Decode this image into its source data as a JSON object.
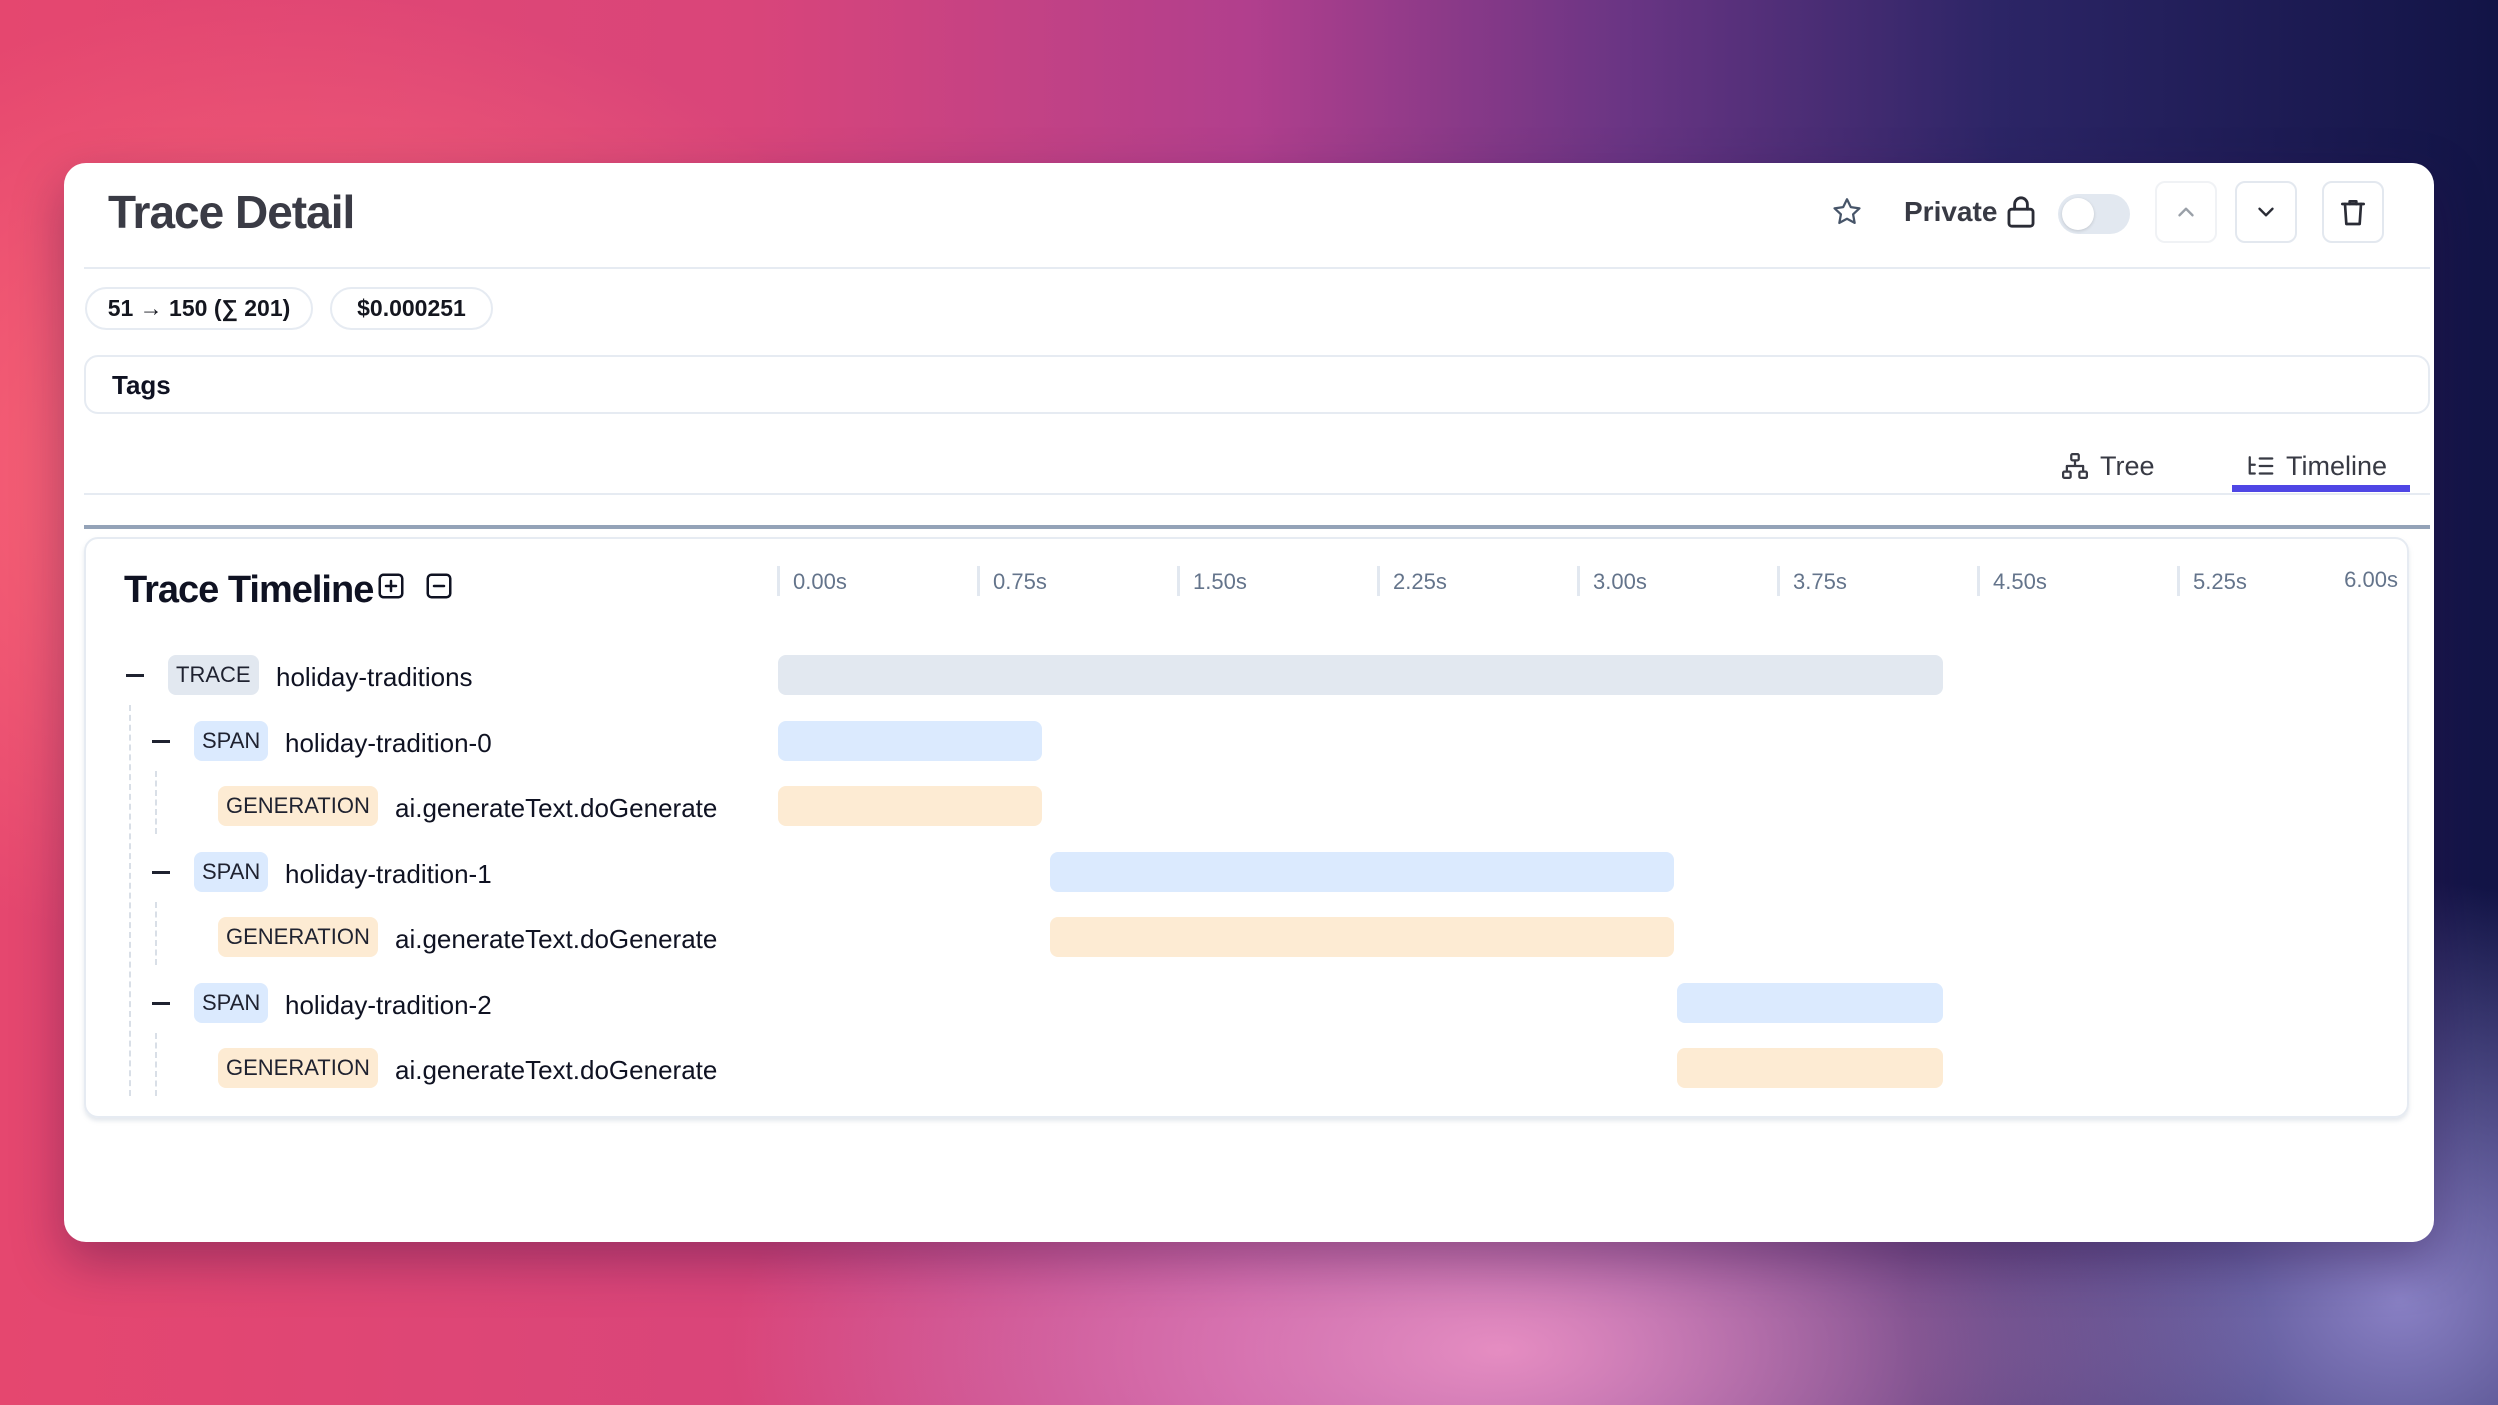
{
  "header": {
    "title": "Trace Detail",
    "private_label": "Private",
    "private_enabled": false,
    "icons": {
      "bookmark": "star-icon",
      "visibility": "lock-icon",
      "previous": "chevron-up-icon",
      "next": "chevron-down-icon",
      "delete": "trash-icon"
    },
    "previous_disabled": true
  },
  "stats": {
    "tokens": "51 → 150 (∑ 201)",
    "cost": "$0.000251"
  },
  "tags": {
    "label": "Tags"
  },
  "view_tabs": [
    {
      "label": "Tree",
      "icon": "tree-icon",
      "active": false
    },
    {
      "label": "Timeline",
      "icon": "timeline-icon",
      "active": true
    }
  ],
  "colors": {
    "accent": "#4f46e5",
    "trace_bar": "#e2e8f0",
    "span_bar": "#dbeafe",
    "generation_bar": "#fdebd3"
  },
  "timeline": {
    "title": "Trace Timeline",
    "expand_all_icon": "plus-square-icon",
    "collapse_all_icon": "minus-square-icon",
    "axis": {
      "min": 0,
      "max": 6.0,
      "ticks": [
        "0.00s",
        "0.75s",
        "1.50s",
        "2.25s",
        "3.00s",
        "3.75s",
        "4.50s",
        "5.25s",
        "6.00s"
      ],
      "tick_values": [
        0,
        0.75,
        1.5,
        2.25,
        3.0,
        3.75,
        4.5,
        5.25,
        6.0
      ]
    },
    "rows": [
      {
        "type": "TRACE",
        "kind": "trace",
        "name": "holiday-traditions",
        "level": 0,
        "collapsible": true,
        "start": 0.0,
        "end": 4.37
      },
      {
        "type": "SPAN",
        "kind": "span",
        "name": "holiday-tradition-0",
        "level": 1,
        "collapsible": true,
        "start": 0.0,
        "end": 0.99
      },
      {
        "type": "GENERATION",
        "kind": "generation",
        "name": "ai.generateText.doGenerate",
        "level": 2,
        "collapsible": false,
        "start": 0.0,
        "end": 0.99
      },
      {
        "type": "SPAN",
        "kind": "span",
        "name": "holiday-tradition-1",
        "level": 1,
        "collapsible": true,
        "start": 1.02,
        "end": 3.36
      },
      {
        "type": "GENERATION",
        "kind": "generation",
        "name": "ai.generateText.doGenerate",
        "level": 2,
        "collapsible": false,
        "start": 1.02,
        "end": 3.36
      },
      {
        "type": "SPAN",
        "kind": "span",
        "name": "holiday-tradition-2",
        "level": 1,
        "collapsible": true,
        "start": 3.37,
        "end": 4.37
      },
      {
        "type": "GENERATION",
        "kind": "generation",
        "name": "ai.generateText.doGenerate",
        "level": 2,
        "collapsible": false,
        "start": 3.37,
        "end": 4.37
      }
    ]
  }
}
